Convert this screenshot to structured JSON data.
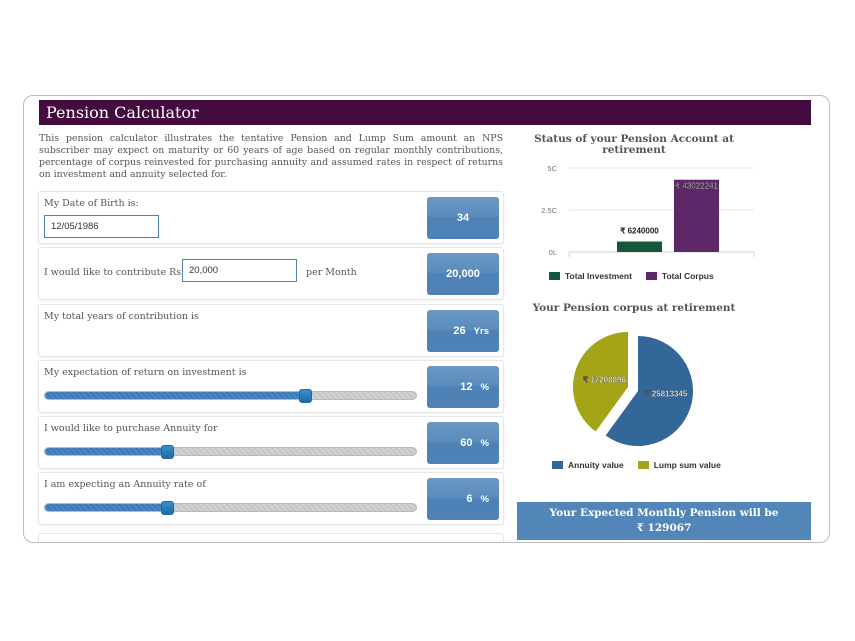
{
  "header": {
    "title": "Pension Calculator"
  },
  "intro_text": "This pension calculator illustrates the tentative Pension and Lump Sum amount an NPS subscriber may expect on maturity or 60 years of age based on regular monthly contributions, percentage of corpus reinvested for purchasing annuity and assumed rates in respect of returns on investment and annuity selected for.",
  "form": {
    "dob": {
      "label": "My Date of Birth is:",
      "value": "12/05/1986",
      "result": "34"
    },
    "contribution": {
      "label": "I would like to contribute Rs",
      "value": "20,000",
      "suffix": "per Month",
      "result": "20,000"
    },
    "years": {
      "label": "My total years of contribution is",
      "result": "26",
      "unit": "Yrs"
    },
    "return_rate": {
      "label": "My expectation of return on investment is",
      "result": "12",
      "unit": "%",
      "slider_fraction": 0.7
    },
    "annuity_pct": {
      "label": "I would like to purchase Annuity for",
      "result": "60",
      "unit": "%",
      "slider_fraction": 0.33
    },
    "annuity_rate": {
      "label": "I am expecting an Annuity rate of",
      "result": "6",
      "unit": "%",
      "slider_fraction": 0.33
    }
  },
  "summary": {
    "line1": "Your Expected Monthly Pension will be",
    "line2": "₹ 129067"
  },
  "colors": {
    "header": "#430b3e",
    "accent": "#5286b9",
    "investment": "#14573a",
    "corpus": "#5e2868",
    "annuity": "#336699",
    "lumpsum": "#a4a416"
  },
  "chart_data": [
    {
      "type": "bar",
      "title": "Status of your Pension Account at retirement",
      "categories": [
        "Total Investment",
        "Total Corpus"
      ],
      "values": [
        6240000,
        43022241
      ],
      "data_labels": [
        "₹ 6240000",
        "₹ 43022241"
      ],
      "yticks": [
        {
          "value": 0,
          "label": "0L"
        },
        {
          "value": 25000000,
          "label": "2.5C"
        },
        {
          "value": 50000000,
          "label": "5C"
        }
      ],
      "ylim": [
        0,
        50000000
      ],
      "legend": [
        "Total Investment",
        "Total Corpus"
      ],
      "legend_position": "bottom",
      "grid": true
    },
    {
      "type": "pie",
      "title": "Your Pension corpus at retirement",
      "slices": [
        {
          "name": "Annuity value",
          "value": 25813345,
          "label": "₹ 25813345"
        },
        {
          "name": "Lump sum value",
          "value": 17208896,
          "label": "₹ 17208896"
        }
      ],
      "legend": [
        "Annuity value",
        "Lump sum value"
      ],
      "legend_position": "bottom"
    }
  ]
}
